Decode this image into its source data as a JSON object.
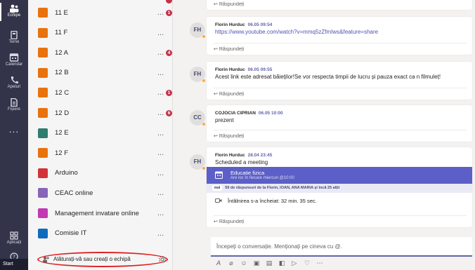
{
  "rail": {
    "items": [
      {
        "label": "Echipe",
        "icon": "teams-icon"
      },
      {
        "label": "Teme",
        "icon": "assignments-icon"
      },
      {
        "label": "Calendar",
        "icon": "calendar-icon"
      },
      {
        "label": "Apeluri",
        "icon": "phone-icon"
      },
      {
        "label": "Fișiere",
        "icon": "files-icon"
      }
    ],
    "more": "...",
    "apps_label": "Aplicații",
    "help_label": "",
    "start_label": "Start"
  },
  "teams": {
    "rows": [
      {
        "name": "11 E",
        "color": "#e8720c",
        "more": "...",
        "badge": "1"
      },
      {
        "name": "11 F",
        "color": "#e8720c",
        "more": "...",
        "badge": ""
      },
      {
        "name": "12 A",
        "color": "#e8720c",
        "more": "...",
        "badge": "4"
      },
      {
        "name": "12 B",
        "color": "#e8720c",
        "more": "...",
        "badge": ""
      },
      {
        "name": "12 C",
        "color": "#e8720c",
        "more": "...",
        "badge": "1"
      },
      {
        "name": "12 D",
        "color": "#e8720c",
        "more": "...",
        "badge": "6"
      },
      {
        "name": "12 E",
        "color": "#2f7d6e",
        "more": "...",
        "badge": ""
      },
      {
        "name": "12 F",
        "color": "#e8720c",
        "more": "...",
        "badge": ""
      },
      {
        "name": "Arduino",
        "color": "#d13438",
        "more": "...",
        "badge": ""
      },
      {
        "name": "CEAC online",
        "color": "#8764b8",
        "more": "...",
        "badge": ""
      },
      {
        "name": "Management invatare online",
        "color": "#c239b3",
        "more": "...",
        "badge": ""
      },
      {
        "name": "Comisie IT",
        "color": "#0f6cbd",
        "more": "...",
        "badge": ""
      }
    ],
    "join_label": "Alăturați-vă sau creați o echipă"
  },
  "conversation": {
    "top_reply": "Răspundeți",
    "posts": [
      {
        "initials": "FH",
        "author": "Florin Hurduc",
        "time": "06.05 09:54",
        "text": "https://www.youtube.com/watch?v=mmq5zZfmIws&feature=share",
        "reply": "Răspundeți"
      },
      {
        "initials": "FH",
        "author": "Florin Hurduc",
        "time": "06.05 09:55",
        "text": "Acest link este adresat băieților!Se vor respecta timpii de lucru și pauza exact ca n filmuleț!",
        "reply": "Răspundeți"
      },
      {
        "initials": "CC",
        "author": "COJOCIA CIPRIAN",
        "time": "06.05 10:00",
        "text": "prezent",
        "reply": "Răspundeți"
      }
    ],
    "meeting_post": {
      "initials": "FH",
      "author": "Florin Hurduc",
      "time": "28.04 23:45",
      "text": "Scheduled a meeting",
      "meeting_title": "Educatie fizica",
      "meeting_schedule": "Are loc în fiecare miercuri @10:00",
      "new_tag": "noi",
      "replies_summary": "59 de răspunsuri de la Florin, IOAN, ANA MARIA și încă 25 alții",
      "ended_text": "Întâlnirea s-a încheiat: 32 min. 35 sec.",
      "reply": "Răspundeți"
    },
    "compose_placeholder": "Începeți o conversație. Menționați pe cineva cu @.",
    "tool_icons": [
      "format-icon",
      "attach-icon",
      "emoji-icon",
      "gif-icon",
      "sticker-icon",
      "meet-icon",
      "send-location-icon",
      "praise-icon",
      "more-icon"
    ]
  }
}
